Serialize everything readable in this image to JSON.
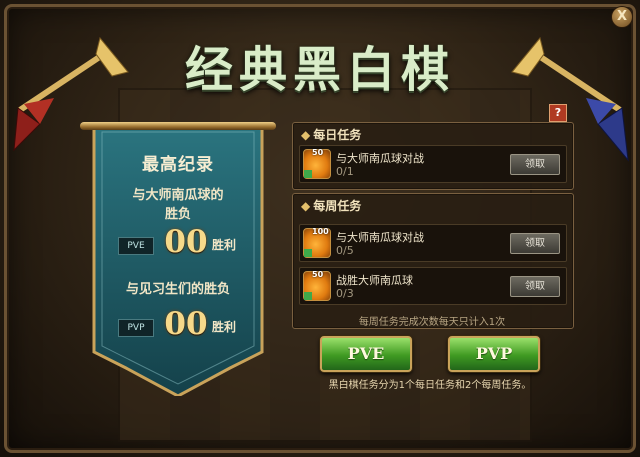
{
  "window": {
    "title": "经典黑白棋",
    "close_label": "X",
    "help_label": "?"
  },
  "record": {
    "heading": "最高纪录",
    "pve_title_line1": "与大师南瓜球的",
    "pve_title_line2": "胜负",
    "pve_tag": "PVE",
    "pve_value": "00",
    "pve_unit": "胜利",
    "pvp_title": "与见习生们的胜负",
    "pvp_tag": "PVP",
    "pvp_value": "00",
    "pvp_unit": "胜利"
  },
  "daily": {
    "header": "每日任务",
    "tasks": [
      {
        "badge": "50",
        "name": "与大师南瓜球对战",
        "progress": "0/1",
        "button": "领取"
      }
    ]
  },
  "weekly": {
    "header": "每周任务",
    "tasks": [
      {
        "badge": "100",
        "name": "与大师南瓜球对战",
        "progress": "0/5",
        "button": "领取"
      },
      {
        "badge": "50",
        "name": "战胜大师南瓜球",
        "progress": "0/3",
        "button": "领取"
      }
    ],
    "note": "每周任务完成次数每天只计入1次"
  },
  "buttons": {
    "pve": "PVE",
    "pvp": "PVP"
  },
  "footer": "黑白棋任务分为1个每日任务和2个每周任务。",
  "colors": {
    "title": "#d9ecc8",
    "banner": "#1f5a63",
    "button_green": "#3f9a22"
  }
}
